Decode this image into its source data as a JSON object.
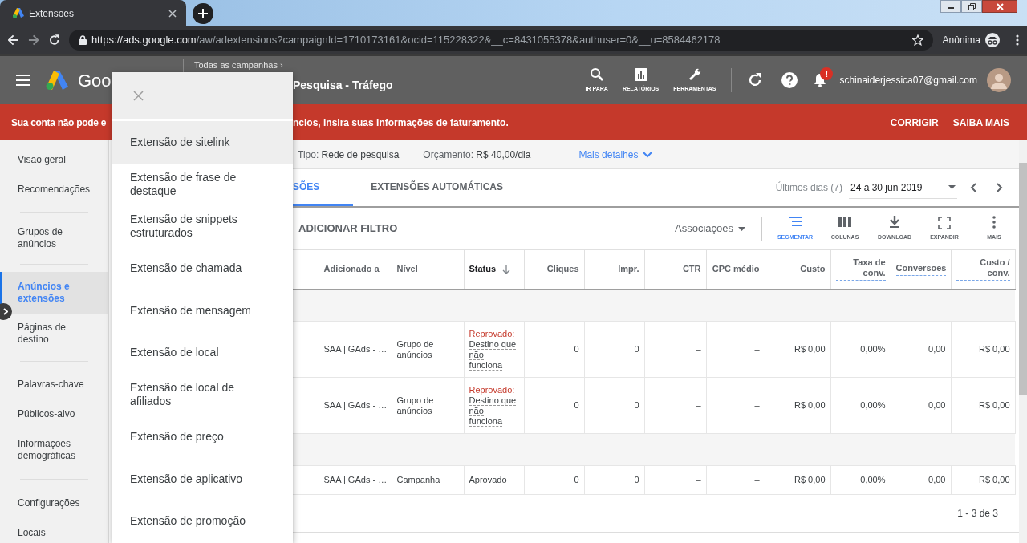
{
  "browser": {
    "tab": {
      "title": "Extensões"
    },
    "url": {
      "host": "https://ads.google.com",
      "path": "/aw/adextensions?campaignId=1710173161&ocid=115228322&__c=8431055378&authuser=0&__u=8584462178"
    },
    "profile": "Anônima"
  },
  "header": {
    "logo_text": "Goo",
    "breadcrumb": "Todas as campanhas ›",
    "campaign": "Pesquisa - Tráfego",
    "tools": [
      {
        "label": "IR PARA"
      },
      {
        "label": "RELATÓRIOS"
      },
      {
        "label": "FERRAMENTAS"
      }
    ],
    "notification_badge": "!",
    "account": "schinaiderjessica07@gmail.com"
  },
  "banner": {
    "text_left": "Sua conta não pode e",
    "text_right": "ncios, insira suas informações de faturamento.",
    "actions": [
      "CORRIGIR",
      "SAIBA MAIS"
    ]
  },
  "sidebar": {
    "items": [
      {
        "kind": "item",
        "label": "Visão geral",
        "selected": false
      },
      {
        "kind": "item",
        "label": "Recomendações",
        "selected": false
      },
      {
        "kind": "divider"
      },
      {
        "kind": "item",
        "label": "Grupos de anúncios",
        "selected": false
      },
      {
        "kind": "divider"
      },
      {
        "kind": "item",
        "label": "Anúncios e extensões",
        "selected": true
      },
      {
        "kind": "item",
        "label": "Páginas de destino",
        "selected": false
      },
      {
        "kind": "divider"
      },
      {
        "kind": "item",
        "label": "Palavras-chave",
        "selected": false
      },
      {
        "kind": "item",
        "label": "Públicos-alvo",
        "selected": false
      },
      {
        "kind": "item",
        "label": "Informações demográficas",
        "selected": false
      },
      {
        "kind": "divider"
      },
      {
        "kind": "item",
        "label": "Configurações",
        "selected": false
      },
      {
        "kind": "item",
        "label": "Locais",
        "selected": false
      }
    ]
  },
  "menu": {
    "items": [
      {
        "label": "Extensão de sitelink",
        "selected": true
      },
      {
        "label": "Extensão de frase de destaque",
        "selected": false
      },
      {
        "label": "Extensão de snippets estruturados",
        "selected": false
      },
      {
        "label": "Extensão de chamada",
        "selected": false
      },
      {
        "label": "Extensão de mensagem",
        "selected": false
      },
      {
        "label": "Extensão de local",
        "selected": false
      },
      {
        "label": "Extensão de local de afiliados",
        "selected": false
      },
      {
        "label": "Extensão de preço",
        "selected": false
      },
      {
        "label": "Extensão de aplicativo",
        "selected": false
      },
      {
        "label": "Extensão de promoção",
        "selected": false
      }
    ]
  },
  "info": [
    {
      "label": "Tipo:",
      "value": "Rede de pesquisa"
    },
    {
      "label": "Orçamento:",
      "value": "R$ 40,00/dia"
    }
  ],
  "details_link": "Mais detalhes",
  "tabs": [
    {
      "label": "SÕES",
      "selected": true
    },
    {
      "label": "EXTENSÕES AUTOMÁTICAS",
      "selected": false
    }
  ],
  "date_range": {
    "label": "Últimos dias (7)",
    "value": "24 a 30 jun 2019"
  },
  "filter": "ADICIONAR FILTRO",
  "view_menu": "Associações",
  "toolbar": [
    {
      "label": "SEGMENTAR",
      "selected": true
    },
    {
      "label": "COLUNAS",
      "selected": false
    },
    {
      "label": "DOWNLOAD",
      "selected": false
    },
    {
      "label": "EXPANDIR",
      "selected": false
    },
    {
      "label": "MAIS",
      "selected": false
    }
  ],
  "table": {
    "columns": [
      {
        "label": "Adicionado a",
        "sorted": false,
        "dashed": false
      },
      {
        "label": "Nível",
        "sorted": false,
        "dashed": false
      },
      {
        "label": "Status",
        "sorted": true,
        "dashed": false
      },
      {
        "label": "Cliques",
        "sorted": false,
        "dashed": false
      },
      {
        "label": "Impr.",
        "sorted": false,
        "dashed": false
      },
      {
        "label": "CTR",
        "sorted": false,
        "dashed": false
      },
      {
        "label": "CPC médio",
        "sorted": false,
        "dashed": false
      },
      {
        "label": "Custo",
        "sorted": false,
        "dashed": false
      },
      {
        "label": "Taxa de conv.",
        "sorted": false,
        "dashed": true
      },
      {
        "label": "Conversões",
        "sorted": false,
        "dashed": true
      },
      {
        "label": "Custo / conv.",
        "sorted": false,
        "dashed": true
      }
    ],
    "rows": [
      {
        "kind": "group"
      },
      {
        "kind": "data",
        "added_to": "SAA | GAds - …",
        "scope": "Grupo de anúncios",
        "status": {
          "kind": "rejected",
          "label": "Reprovado:",
          "reason": "Destino que não funciona"
        },
        "cells": [
          "0",
          "0",
          "–",
          "–",
          "R$ 0,00",
          "0,00%",
          "0,00",
          "R$ 0,00"
        ]
      },
      {
        "kind": "data",
        "added_to": "SAA | GAds - …",
        "scope": "Grupo de anúncios",
        "status": {
          "kind": "rejected",
          "label": "Reprovado:",
          "reason": "Destino que não funciona"
        },
        "cells": [
          "0",
          "0",
          "–",
          "–",
          "R$ 0,00",
          "0,00%",
          "0,00",
          "R$ 0,00"
        ]
      },
      {
        "kind": "group"
      },
      {
        "kind": "data",
        "added_to": "SAA | GAds - …",
        "scope": "Campanha",
        "status": {
          "kind": "approved",
          "label": "Aprovado"
        },
        "cells": [
          "0",
          "0",
          "–",
          "–",
          "R$ 0,00",
          "0,00%",
          "0,00",
          "R$ 0,00"
        ]
      }
    ]
  },
  "pagination": "1 - 3 de 3"
}
